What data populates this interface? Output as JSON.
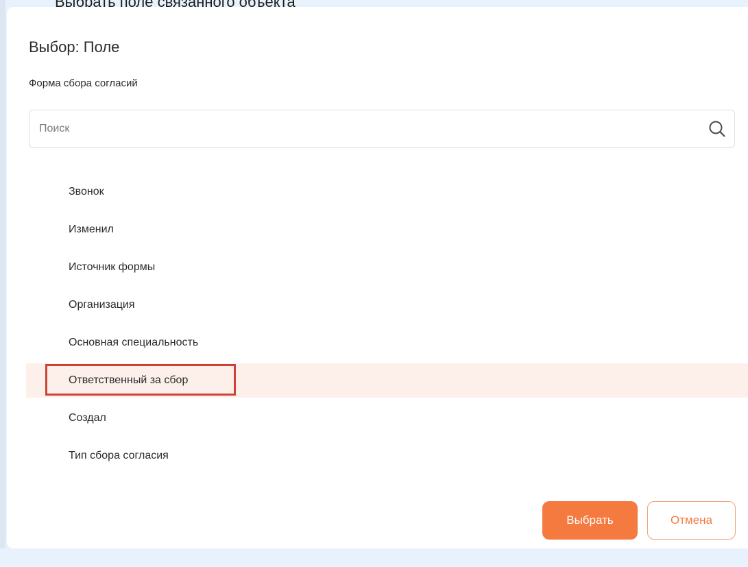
{
  "background": {
    "caption": "Выбрать поле связанного объекта"
  },
  "dialog": {
    "title": "Выбор: Поле",
    "subtitle": "Форма сбора согласий",
    "search": {
      "placeholder": "Поиск",
      "value": "",
      "icon": "search-icon"
    },
    "fields": [
      {
        "label": "Звонок",
        "selected": false
      },
      {
        "label": "Изменил",
        "selected": false
      },
      {
        "label": "Источник формы",
        "selected": false
      },
      {
        "label": "Организация",
        "selected": false
      },
      {
        "label": "Основная специальность",
        "selected": false
      },
      {
        "label": "Ответственный за сбор",
        "selected": true
      },
      {
        "label": "Создал",
        "selected": false
      },
      {
        "label": "Тип сбора согласия",
        "selected": false
      }
    ],
    "buttons": {
      "select_label": "Выбрать",
      "cancel_label": "Отмена"
    }
  },
  "colors": {
    "page_background": "#e8f2fc",
    "accent": "#f47a3f",
    "selected_row": "#fdf0ea",
    "highlight_frame": "#cc4438"
  }
}
